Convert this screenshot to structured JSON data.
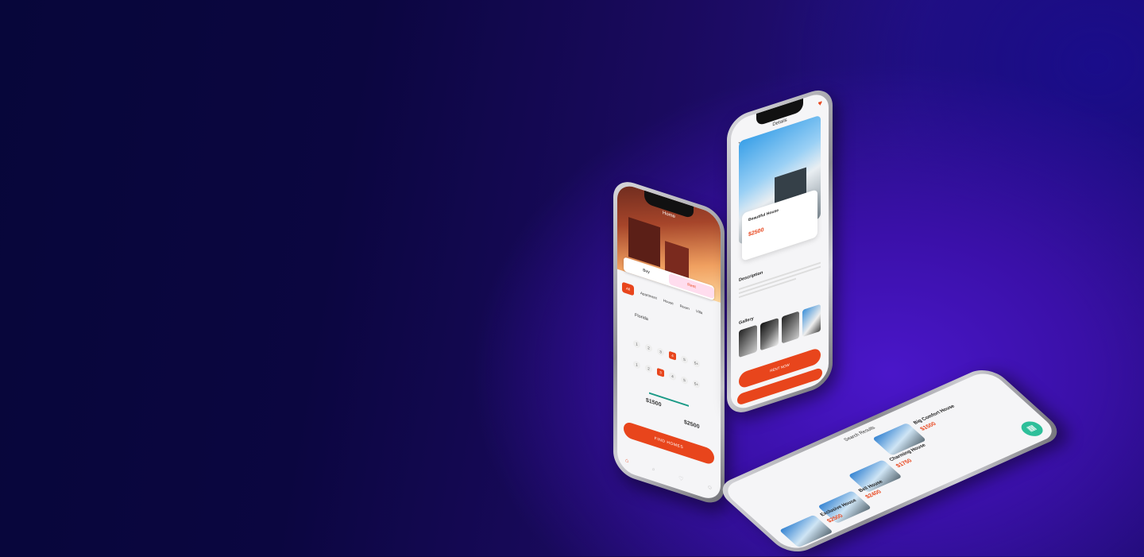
{
  "phone_home": {
    "title": "Home",
    "segments": [
      "Buy",
      "Rent"
    ],
    "categories": [
      "All",
      "Apartment",
      "House",
      "Room",
      "Villa"
    ],
    "location": "Florida",
    "beds": [
      "1",
      "2",
      "3",
      "4",
      "5",
      "5+"
    ],
    "baths": [
      "1",
      "2",
      "3",
      "4",
      "5",
      "5+"
    ],
    "price_min": "$1500",
    "price_max": "$2500",
    "cta": "FIND HOMES"
  },
  "phone_details": {
    "title": "Details",
    "name": "Beautiful House",
    "price": "$2500",
    "description_heading": "Description",
    "gallery_heading": "Gallery",
    "cta": "RENT NOW"
  },
  "phone_results": {
    "title": "Search Results",
    "listings": [
      {
        "name": "Big Comfort House",
        "price": "$1500"
      },
      {
        "name": "Charming House",
        "price": "$1750"
      },
      {
        "name": "Bell House",
        "price": "$2400"
      },
      {
        "name": "Exclusive House",
        "price": "$2500"
      }
    ]
  }
}
